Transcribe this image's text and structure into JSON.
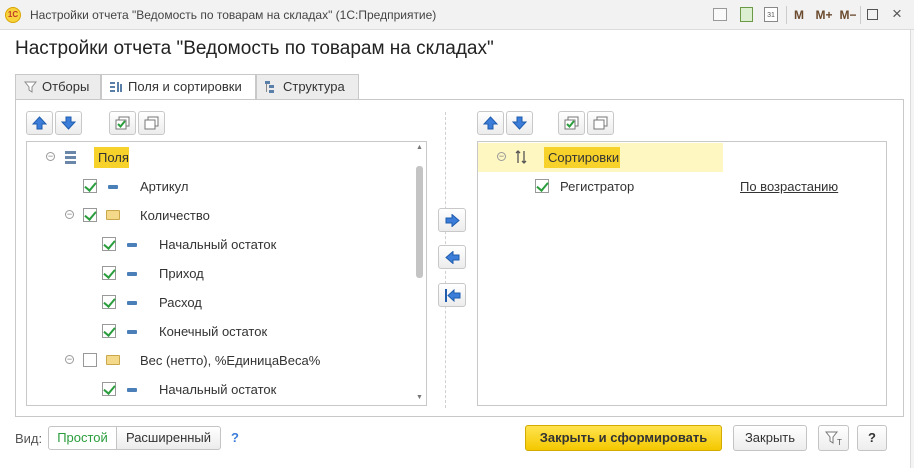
{
  "window": {
    "title": "Настройки отчета \"Ведомость по товарам на складах\"  (1С:Предприятие)",
    "logo_text": "1С",
    "buttons": [
      "M",
      "M+",
      "M−"
    ]
  },
  "page_title": "Настройки отчета \"Ведомость по товарам на складах\"",
  "tabs": [
    {
      "label": "Отборы",
      "icon": "filter-icon"
    },
    {
      "label": "Поля и сортировки",
      "icon": "fields-icon"
    },
    {
      "label": "Структура",
      "icon": "structure-icon"
    }
  ],
  "active_tab": "Поля и сортировки",
  "fields_tree": {
    "root_label": "Поля",
    "rows": [
      {
        "label": "Артикул",
        "checked": true,
        "kind": "field",
        "level": 1
      },
      {
        "label": "Количество",
        "checked": true,
        "kind": "folder",
        "level": 1,
        "expanded": true
      },
      {
        "label": "Начальный остаток",
        "checked": true,
        "kind": "field",
        "level": 2
      },
      {
        "label": "Приход",
        "checked": true,
        "kind": "field",
        "level": 2
      },
      {
        "label": "Расход",
        "checked": true,
        "kind": "field",
        "level": 2
      },
      {
        "label": "Конечный остаток",
        "checked": true,
        "kind": "field",
        "level": 2
      },
      {
        "label": "Вес (нетто), %ЕдиницаВеса%",
        "checked": false,
        "kind": "folder",
        "level": 1,
        "expanded": true
      },
      {
        "label": "Начальный остаток",
        "checked": true,
        "kind": "field",
        "level": 2
      }
    ]
  },
  "sort_tree": {
    "root_label": "Сортировки",
    "rows": [
      {
        "label": "Регистратор",
        "checked": true,
        "direction": "По возрастанию"
      }
    ]
  },
  "footer": {
    "view_label": "Вид:",
    "view_simple": "Простой",
    "view_extended": "Расширенный",
    "help_mark": "?",
    "close_and_generate": "Закрыть и сформировать",
    "close": "Закрыть",
    "help_button": "?"
  },
  "colors": {
    "accent_yellow": "#f4c800",
    "highlight_row": "#fff7c2",
    "check_green": "#2a9d3c",
    "arrow_blue": "#3b7dd8"
  }
}
